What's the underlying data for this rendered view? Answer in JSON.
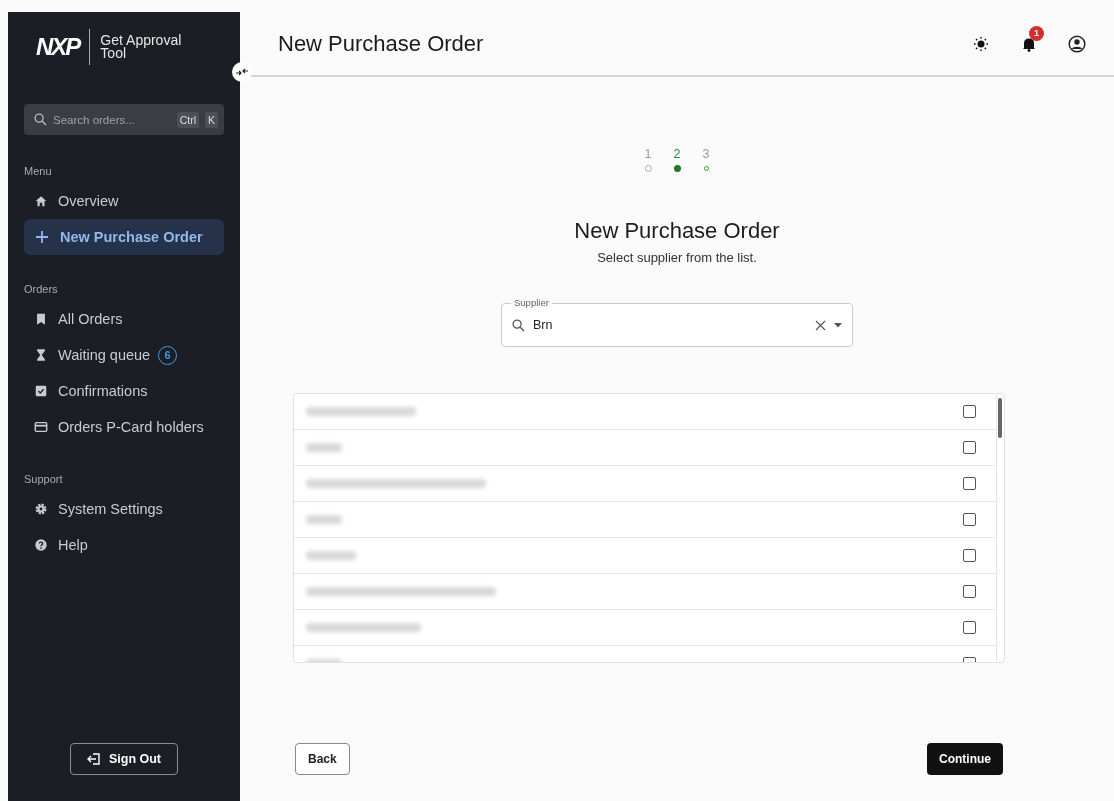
{
  "sidebar": {
    "logo": "NXP",
    "app_name": "Get Approval Tool",
    "search": {
      "placeholder": "Search orders...",
      "shortcut": [
        "Ctrl",
        "K"
      ]
    },
    "sections": [
      {
        "title": "Menu",
        "items": [
          {
            "label": "Overview",
            "selected": false
          },
          {
            "label": "New Purchase Order",
            "selected": true
          }
        ]
      },
      {
        "title": "Orders",
        "items": [
          {
            "label": "All Orders",
            "selected": false
          },
          {
            "label": "Waiting queue",
            "selected": false,
            "badge": "6"
          },
          {
            "label": "Confirmations",
            "selected": false
          },
          {
            "label": "Orders P-Card holders",
            "selected": false
          }
        ]
      },
      {
        "title": "Support",
        "items": [
          {
            "label": "System Settings",
            "selected": false
          },
          {
            "label": "Help",
            "selected": false
          }
        ]
      }
    ],
    "sign_out": "Sign Out"
  },
  "header": {
    "title": "New Purchase Order",
    "notifications": "1"
  },
  "stepper": [
    {
      "label": "1",
      "kind": "done"
    },
    {
      "label": "2",
      "kind": "current"
    },
    {
      "label": "3",
      "kind": "upcoming"
    }
  ],
  "form": {
    "title": "New Purchase Order",
    "subtitle": "Select supplier from the list.",
    "supplier": {
      "label": "Supplier",
      "value": "Brn"
    }
  },
  "suppliers": [
    {
      "checked": false
    },
    {
      "checked": false
    },
    {
      "checked": false
    },
    {
      "checked": false
    },
    {
      "checked": false
    },
    {
      "checked": false
    },
    {
      "checked": false
    },
    {
      "checked": false
    }
  ],
  "buttons": {
    "back": "Back",
    "continue": "Continue"
  }
}
